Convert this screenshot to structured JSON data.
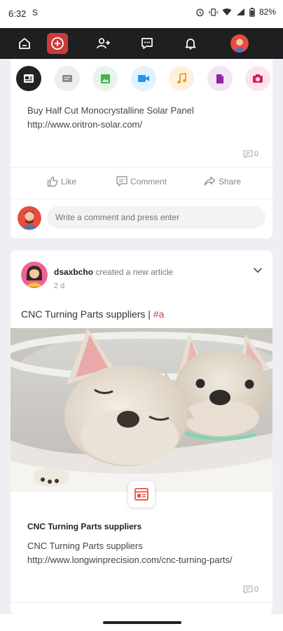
{
  "status_bar": {
    "time": "6:32",
    "sim_icon": "S",
    "battery": "82%",
    "icons": [
      "alarm-icon",
      "vibrate-icon",
      "wifi-icon",
      "signal-icon",
      "battery-icon"
    ]
  },
  "nav": {
    "items": [
      "home-icon",
      "add-icon",
      "add-user-icon",
      "messages-icon",
      "notifications-icon",
      "profile-avatar"
    ],
    "accent": "#cc3b3b",
    "background": "#1d1f20"
  },
  "post1": {
    "attachment_types": [
      "photo-album-icon",
      "text-icon",
      "image-icon",
      "video-icon",
      "music-icon",
      "file-icon",
      "camera-icon"
    ],
    "text": "Buy Half Cut Monocrystalline Solar Panel",
    "link": "http://www.oritron-solar.com/",
    "comment_count": "0",
    "like_label": "Like",
    "comment_label": "Comment",
    "share_label": "Share",
    "comment_placeholder": "Write a comment and press enter"
  },
  "post2": {
    "author": "dsaxbcho",
    "action": "created a new article",
    "time": "2 d",
    "title": "CNC Turning Parts suppliers |",
    "hashtag": "#a",
    "article_title": "CNC Turning Parts suppliers",
    "article_text": "CNC Turning Parts suppliers",
    "article_link": "http://www.longwinprecision.com/cnc-turning-parts/",
    "comment_count": "0"
  }
}
